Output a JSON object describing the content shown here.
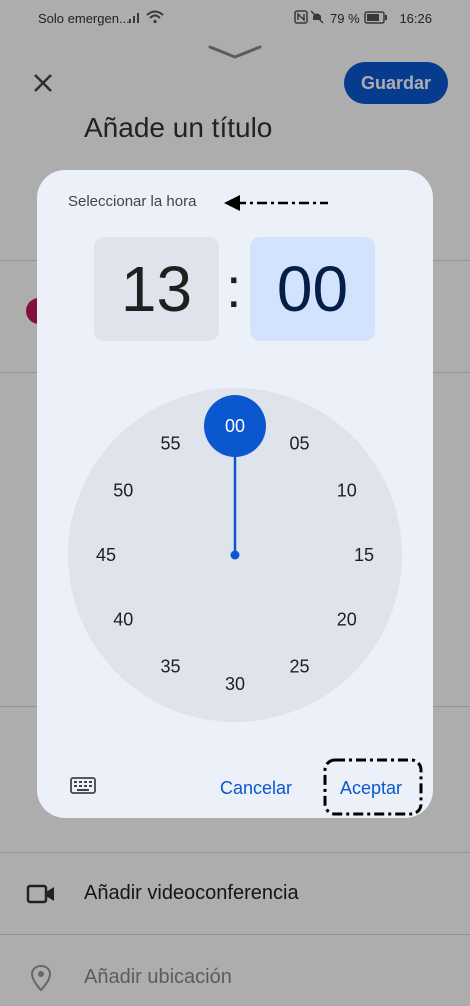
{
  "status_bar": {
    "carrier": "Solo emergen...",
    "battery": "79 %",
    "time": "16:26"
  },
  "header": {
    "save_label": "Guardar",
    "title": "Añade un título"
  },
  "rows": {
    "video": "Añadir videoconferencia",
    "location": "Añadir ubicación"
  },
  "dialog": {
    "heading": "Seleccionar la hora",
    "hour": "13",
    "separator": ":",
    "minute": "00",
    "clock_labels": [
      "00",
      "05",
      "10",
      "15",
      "20",
      "25",
      "30",
      "35",
      "40",
      "45",
      "50",
      "55"
    ],
    "selected_label": "00",
    "cancel_label": "Cancelar",
    "accept_label": "Aceptar"
  },
  "colors": {
    "accent": "#0b57d0",
    "dialog_bg": "#ecf0f8",
    "dial_bg": "#dfe3eb",
    "minute_bg": "#d3e3fd"
  }
}
